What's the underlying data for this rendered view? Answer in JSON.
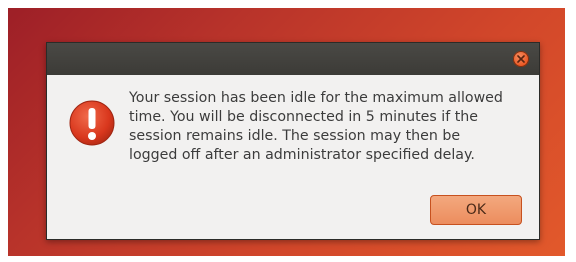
{
  "dialog": {
    "message_lines": [
      "Your session has been idle for the maximum allowed",
      "time. You will be disconnected in 5 minutes if the",
      "session remains idle. The session may then be",
      "logged off after an administrator specified delay."
    ],
    "ok_label": "OK",
    "icon": "warning-icon"
  },
  "colors": {
    "titlebar": "#3c3b37",
    "close_button": "#e95420",
    "warning_icon": "#d9371d",
    "ok_button": "#ec8d5e",
    "dialog_body": "#f2f1f0",
    "desktop_background": "#c73d28"
  }
}
